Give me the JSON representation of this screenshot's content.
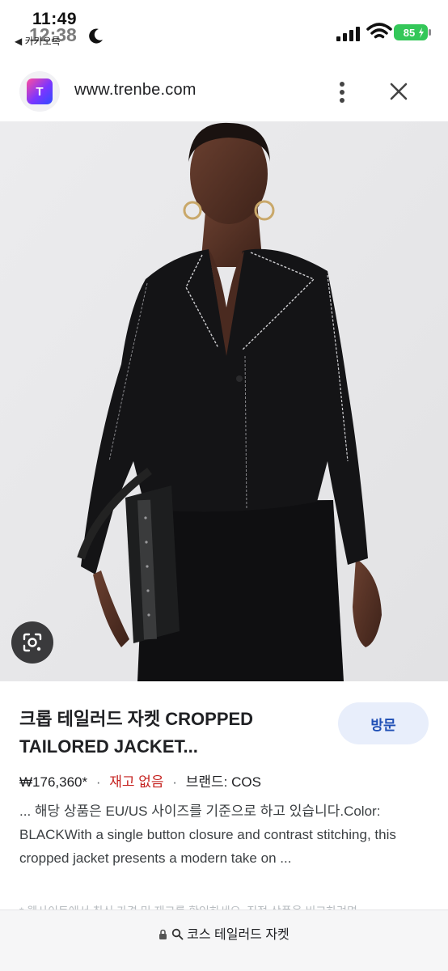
{
  "status_bar": {
    "time": "11:49",
    "time_ghost": "12:38",
    "back_app": "◀ 카카오톡",
    "battery": "85"
  },
  "browser": {
    "url": "www.trenbe.com",
    "site_logo_text": "T"
  },
  "result": {
    "title": "크롭 테일러드 자켓 CROPPED TAILORED JACKET...",
    "visit_label": "방문",
    "price": "₩176,360*",
    "stock": "재고 없음",
    "separator": "·",
    "brand": "브랜드: COS",
    "description": "... 해당 상품은 EU/US 사이즈를 기준으로 하고 있습니다.Color: BLACKWith a single button closure and contrast stitching, this cropped jacket presents a modern take on ...",
    "faded_text": "* 웹사이트에서 최신 가격 및 재고를 확인하세요. 직접 상품을 비교하려면"
  },
  "bottom_bar": {
    "query": "코스 테일러드 자켓"
  },
  "colors": {
    "accent_blue": "#1f4fb5",
    "visit_bg": "#e8eefb",
    "stock_red": "#c5221f",
    "jacket": "#141416"
  }
}
